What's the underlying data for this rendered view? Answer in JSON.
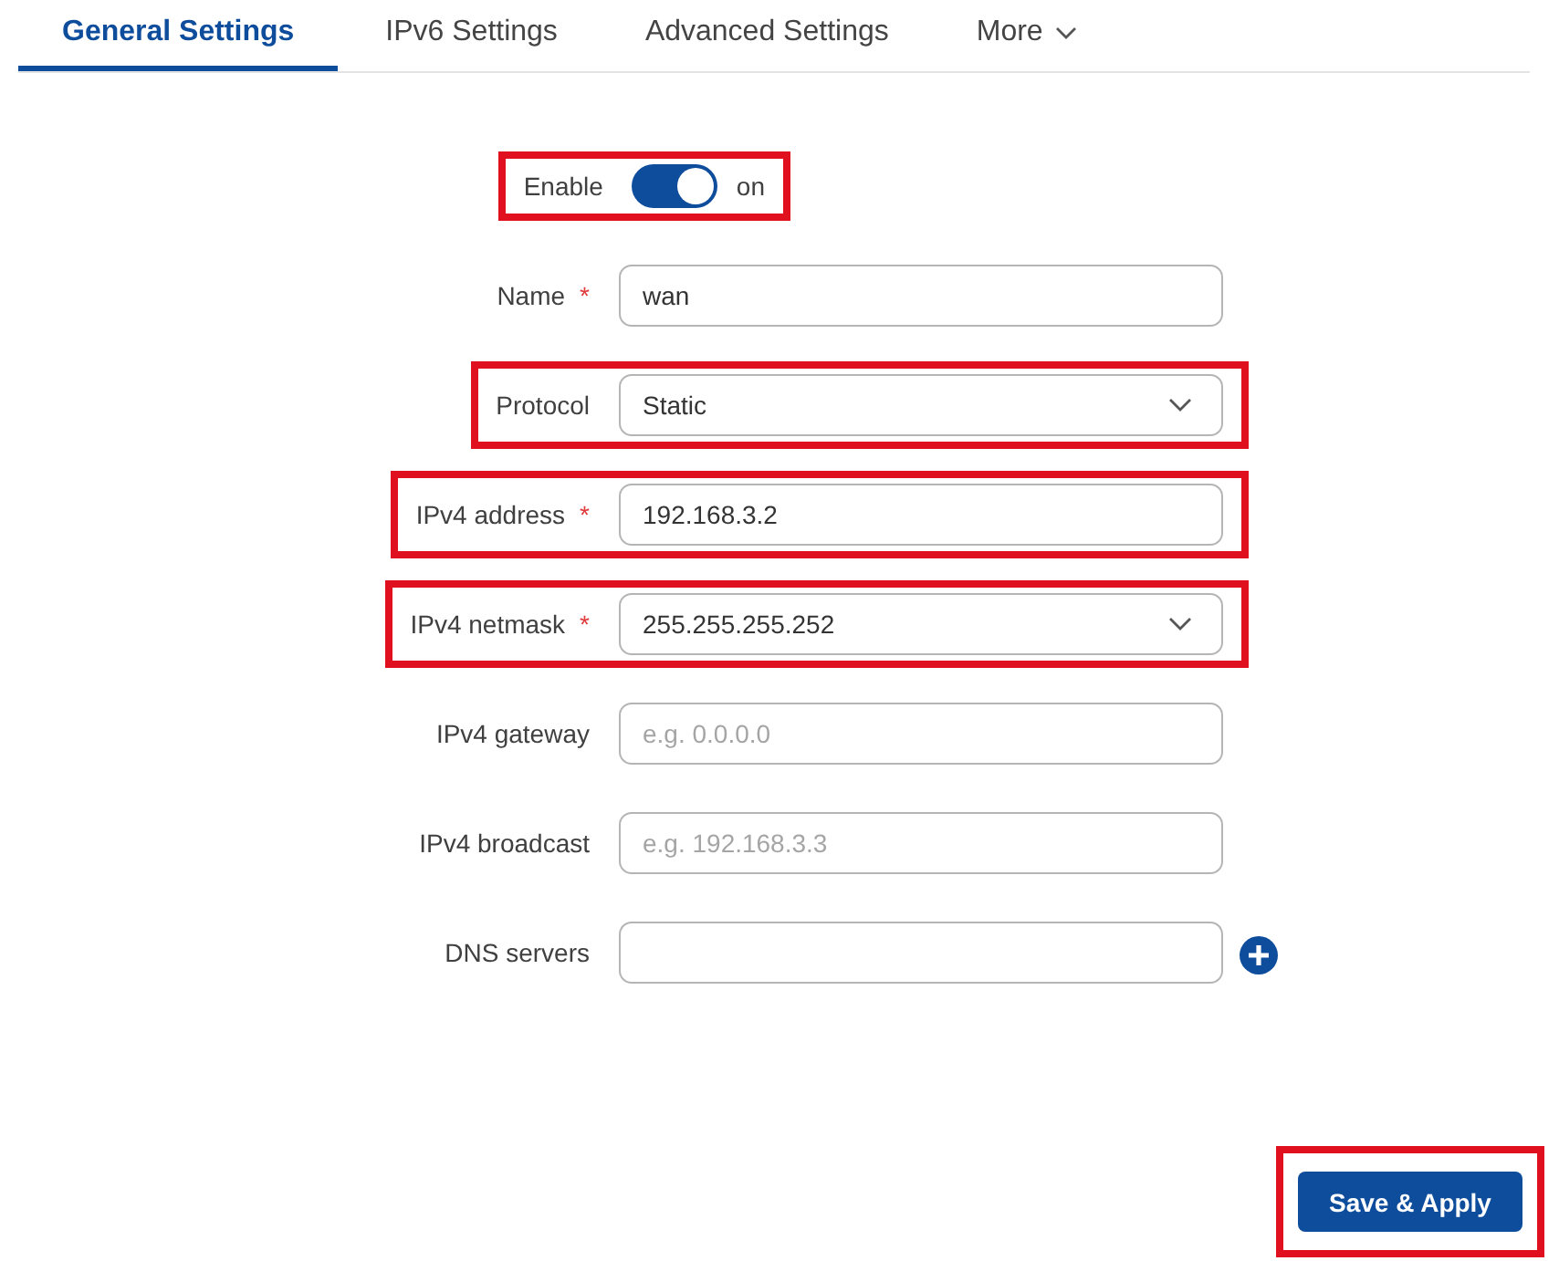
{
  "tabs": [
    {
      "kind": "tab",
      "label": "General Settings",
      "selected": true
    },
    {
      "kind": "tab",
      "label": "IPv6 Settings",
      "selected": false
    },
    {
      "kind": "tab",
      "label": "Advanced Settings",
      "selected": false
    },
    {
      "kind": "dropdown",
      "label": "More",
      "selected": false
    }
  ],
  "enable": {
    "label": "Enable",
    "on": true,
    "state_text": "on",
    "highlighted": true
  },
  "fields": [
    {
      "kind": "text",
      "label": "Name",
      "required_mark": "*",
      "value": "wan",
      "highlighted": false
    },
    {
      "kind": "select",
      "label": "Protocol",
      "value": "Static",
      "highlighted": true
    },
    {
      "kind": "text",
      "label": "IPv4 address",
      "required_mark": "*",
      "value": "192.168.3.2",
      "highlighted": true
    },
    {
      "kind": "select",
      "label": "IPv4 netmask",
      "required_mark": "*",
      "value": "255.255.255.252",
      "highlighted": true
    },
    {
      "kind": "text",
      "label": "IPv4 gateway",
      "placeholder": "e.g. 0.0.0.0",
      "highlighted": false
    },
    {
      "kind": "text",
      "label": "IPv4 broadcast",
      "placeholder": "e.g. 192.168.3.3",
      "highlighted": false
    },
    {
      "kind": "text",
      "label": "DNS servers",
      "add_button": true,
      "highlighted": false
    }
  ],
  "save_button": {
    "label": "Save & Apply",
    "highlighted": true
  }
}
